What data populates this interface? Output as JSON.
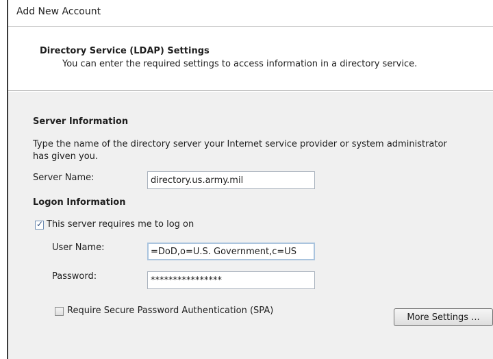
{
  "window": {
    "title": "Add New Account"
  },
  "header": {
    "title": "Directory Service (LDAP) Settings",
    "subtitle": "You can enter the required settings to access information in a directory service."
  },
  "server_info": {
    "heading": "Server Information",
    "description_line1": "Type the name of the directory server your Internet service provider or system administrator",
    "description_line2": "has given you.",
    "server_name_label": "Server Name:",
    "server_name_value": "directory.us.army.mil"
  },
  "logon_info": {
    "heading": "Logon Information",
    "requires_logon_label": "This server requires me to log on",
    "requires_logon_checked": true,
    "user_name_label": "User Name:",
    "user_name_value": "=DoD,o=U.S. Government,c=US",
    "password_label": "Password:",
    "password_value": "****************",
    "spa_label": "Require Secure Password Authentication (SPA)",
    "spa_checked": false
  },
  "buttons": {
    "more_settings": "More Settings ..."
  }
}
